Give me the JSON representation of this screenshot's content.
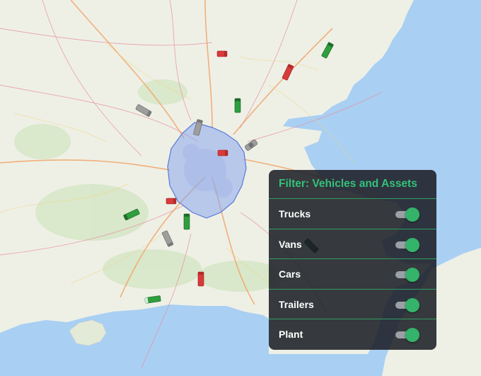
{
  "filter": {
    "title": "Filter: Vehicles and Assets",
    "items": [
      {
        "label": "Trucks",
        "enabled": true
      },
      {
        "label": "Vans",
        "enabled": true
      },
      {
        "label": "Cars",
        "enabled": true
      },
      {
        "label": "Trailers",
        "enabled": true
      },
      {
        "label": "Plant",
        "enabled": true
      }
    ]
  },
  "colors": {
    "sea": "#a9cff3",
    "land": "#eef0e6",
    "zone_fill": "#7f9ff0",
    "zone_stroke": "#5a78d8",
    "panel_bg": "#1c1f26",
    "accent_green": "#33c07a",
    "toggle_knob": "#34b36a",
    "vehicle_green": "#2e9e3e",
    "vehicle_red": "#d93a3a",
    "vehicle_grey": "#9e9e9e"
  }
}
